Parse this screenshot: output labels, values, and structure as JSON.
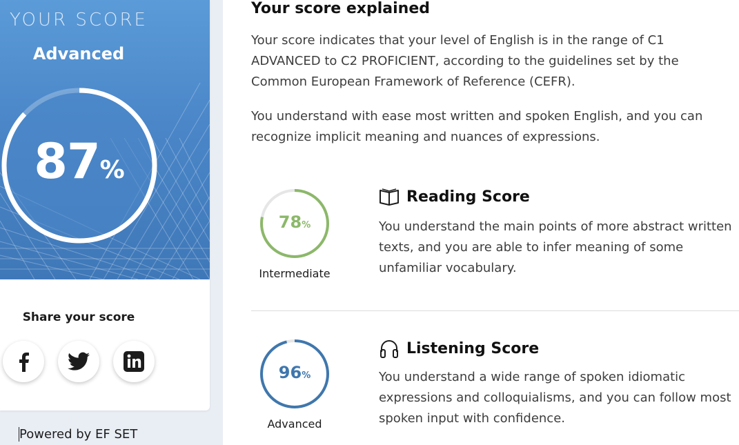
{
  "score": {
    "heading": "YOUR SCORE",
    "level": "Advanced",
    "percent_value": "87",
    "percent_symbol": "%",
    "percent_fraction": 0.87,
    "ring_color": "#ffffff",
    "hero_color": "#4a86c8"
  },
  "share": {
    "label": "Share your score",
    "buttons": [
      {
        "name": "facebook",
        "icon": "facebook-icon"
      },
      {
        "name": "twitter",
        "icon": "twitter-icon"
      },
      {
        "name": "linkedin",
        "icon": "linkedin-icon"
      }
    ]
  },
  "footer": {
    "powered_by": "Powered by EF SET"
  },
  "explanation": {
    "title": "Your score explained",
    "paragraph1": "Your score indicates that your level of English is in the range of C1 ADVANCED to C2 PROFICIENT, according to the guidelines set by the Common European Framework of Reference (CEFR).",
    "paragraph2": "You understand with ease most written and spoken English, and you can recognize implicit meaning and nuances of expressions."
  },
  "reading": {
    "title": "Reading Score",
    "icon": "book-icon",
    "percent_value": "78",
    "percent_symbol": "%",
    "percent_fraction": 0.78,
    "level": "Intermediate",
    "color": "#8cb86a",
    "description": "You understand the main points of more abstract written texts, and you are able to infer meaning of some unfamiliar vocabulary."
  },
  "listening": {
    "title": "Listening Score",
    "icon": "headphones-icon",
    "percent_value": "96",
    "percent_symbol": "%",
    "percent_fraction": 0.96,
    "level": "Advanced",
    "color": "#3f77ad",
    "description": "You understand a wide range of spoken idiomatic expressions and colloquialisms, and you can follow most spoken input with confidence."
  }
}
